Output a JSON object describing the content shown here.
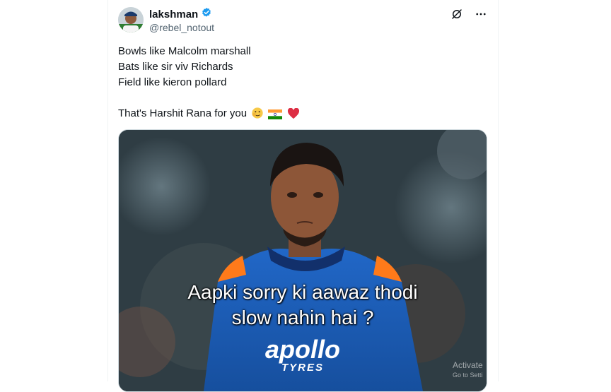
{
  "tweet": {
    "author": {
      "display_name": "lakshman",
      "handle": "@rebel_notout",
      "verified_icon": "verified-badge-icon"
    },
    "actions": {
      "grok_icon": "grok-icon",
      "more_icon": "more-dots-icon"
    },
    "text_lines": [
      "Bowls like Malcolm marshall",
      "Bats like sir viv Richards",
      "Field like kieron pollard",
      "That's Harshit Rana for you"
    ],
    "emojis": [
      "face-with-peeking-eye-icon",
      "india-flag-icon",
      "red-heart-icon"
    ],
    "media": {
      "caption_line1": "Aapki sorry ki aawaz thodi",
      "caption_line2": "slow nahin hai ?",
      "jersey_text": "apollo",
      "jersey_sub": "TYRES",
      "watermark_line1": "Activate",
      "watermark_line2": "Go to Setti"
    }
  },
  "colors": {
    "verified": "#1d9bf0",
    "text_primary": "#0f1419",
    "text_secondary": "#536471",
    "jersey_blue": "#1b5fc0"
  }
}
